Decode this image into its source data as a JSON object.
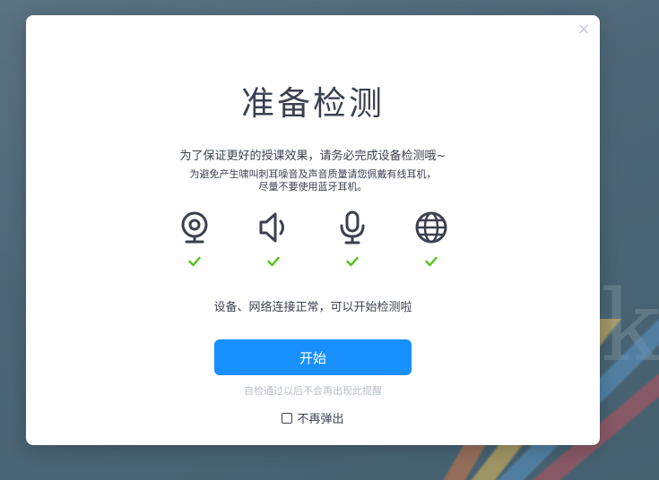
{
  "dialog": {
    "close_label": "×",
    "title": "准备检测",
    "subtitle": "为了保证更好的授课效果，请务必完成设备检测哦~",
    "note_line1": "为避免产生啸叫刺耳噪音及声音质量请您佩戴有线耳机，",
    "note_line2": "尽量不要使用蓝牙耳机。",
    "devices": [
      {
        "icon": "webcam-icon",
        "status": "ok"
      },
      {
        "icon": "speaker-icon",
        "status": "ok"
      },
      {
        "icon": "microphone-icon",
        "status": "ok"
      },
      {
        "icon": "globe-icon",
        "status": "ok"
      }
    ],
    "status_text": "设备、网络连接正常，可以开始检测啦",
    "start_label": "开始",
    "hint_text": "自检通过以后不会再出现此提醒",
    "no_show_label": "不再弹出"
  },
  "colors": {
    "accent": "#1890ff",
    "check": "#52c41a",
    "icon": "#3b4150",
    "hint": "#b7bcc4"
  }
}
